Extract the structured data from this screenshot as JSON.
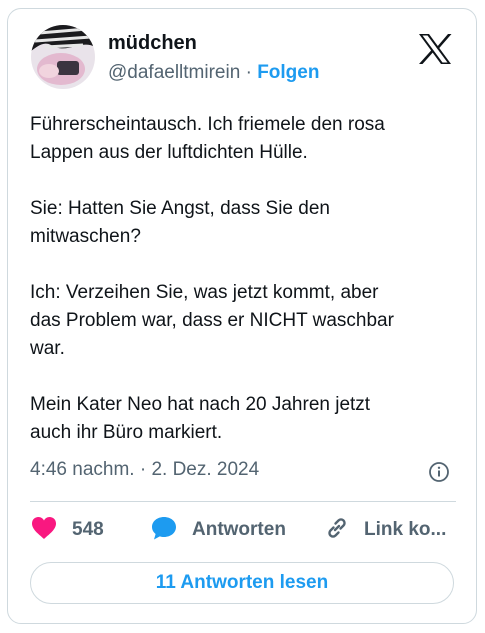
{
  "author": {
    "name": "müdchen",
    "handle": "@dafaelltmirein",
    "separator": "·",
    "follow_label": "Folgen"
  },
  "tweet": {
    "text": "Führerscheintausch. Ich friemele den rosa\nLappen aus der luftdichten Hülle.\n\nSie: Hatten Sie Angst, dass Sie den\nmitwaschen?\n\nIch: Verzeihen Sie, was jetzt kommt, aber\ndas Problem war, dass er NICHT waschbar\nwar.\n\nMein Kater Neo hat nach 20 Jahren jetzt\nauch ihr Büro markiert.",
    "timestamp": "4:46 nachm. · 2. Dez. 2024"
  },
  "actions": {
    "like_count": "548",
    "reply_label": "Antworten",
    "link_label": "Link ko..."
  },
  "read_replies_label": "11 Antworten lesen",
  "icons": {
    "brand": "x-logo-icon",
    "info": "info-icon",
    "like": "heart-icon",
    "reply": "speech-bubble-icon",
    "link": "link-icon"
  },
  "colors": {
    "accent": "#1d9bf0",
    "like": "#f91880",
    "muted": "#536471",
    "border": "#cfd9de"
  }
}
